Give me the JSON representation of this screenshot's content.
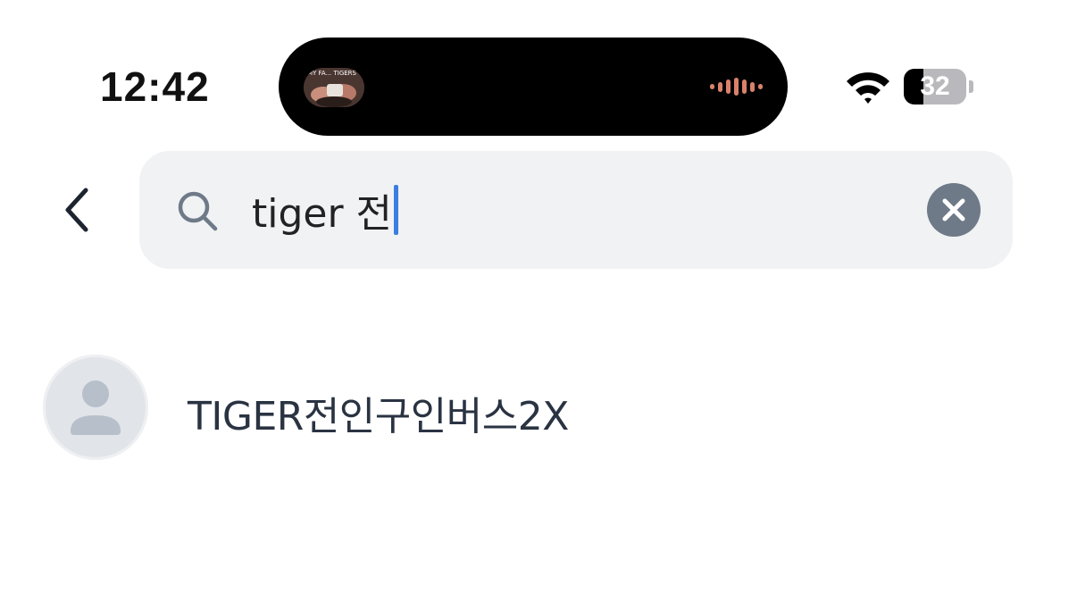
{
  "status_bar": {
    "time": "12:42",
    "battery_level": "32",
    "battery_fraction": 0.32,
    "now_playing_caption": "MY FA... TIGERS",
    "icons": [
      "wifi-icon",
      "battery-icon",
      "audio-waveform-icon"
    ]
  },
  "search": {
    "query": "tiger 전",
    "back_icon": "chevron-left-icon",
    "search_icon": "search-icon",
    "clear_icon": "clear-x-icon"
  },
  "results": [
    {
      "name": "TIGER전인구인버스2X",
      "avatar_icon": "person-placeholder-icon"
    }
  ],
  "colors": {
    "search_bg": "#f1f2f4",
    "caret": "#3b7de0",
    "clear_button": "#6f7a88",
    "result_text": "#2a3342",
    "avatar_bg": "#e1e4e8",
    "wave": "#d9826a"
  }
}
